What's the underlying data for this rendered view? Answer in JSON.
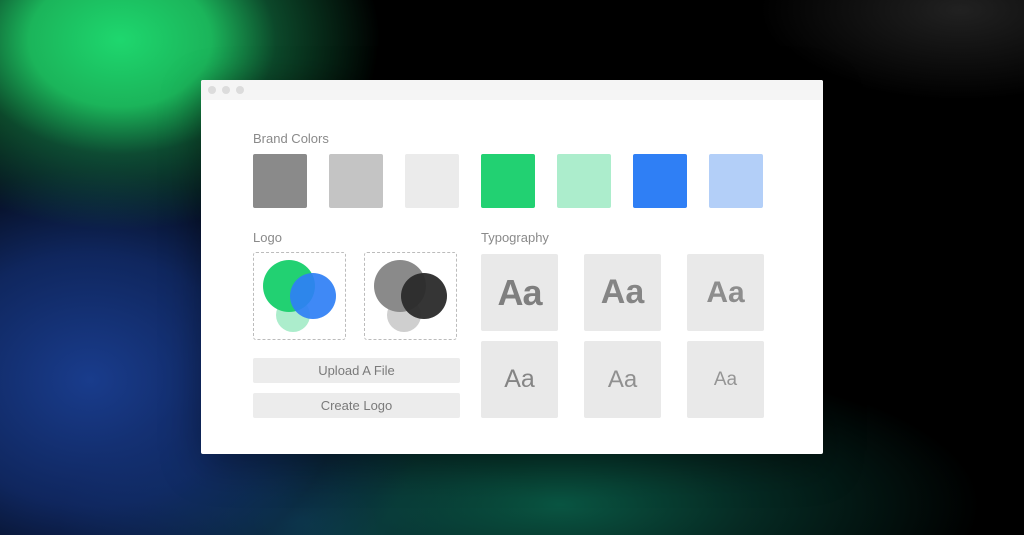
{
  "window": {
    "controls": [
      "close",
      "minimize",
      "maximize"
    ]
  },
  "brand_colors": {
    "label": "Brand Colors",
    "swatches": [
      "#8a8a8a",
      "#c4c4c4",
      "#ebebeb",
      "#22d172",
      "#acedcc",
      "#2f7ff5",
      "#b3cff8"
    ]
  },
  "logo": {
    "label": "Logo",
    "variants": [
      {
        "name": "color-logo",
        "colors": [
          "#22d172",
          "#2f7ff5",
          "#acedcc"
        ]
      },
      {
        "name": "mono-logo",
        "colors": [
          "#8a8a8a",
          "#2a2a2a",
          "#cfcfcf"
        ]
      }
    ],
    "upload_button": "Upload A File",
    "create_button": "Create Logo"
  },
  "typography": {
    "label": "Typography",
    "samples": [
      {
        "text": "Aa",
        "weight": "heavy"
      },
      {
        "text": "Aa",
        "weight": "bold"
      },
      {
        "text": "Aa",
        "weight": "semibold"
      },
      {
        "text": "Aa",
        "weight": "medium"
      },
      {
        "text": "Aa",
        "weight": "regular"
      },
      {
        "text": "Aa",
        "weight": "light"
      }
    ]
  }
}
